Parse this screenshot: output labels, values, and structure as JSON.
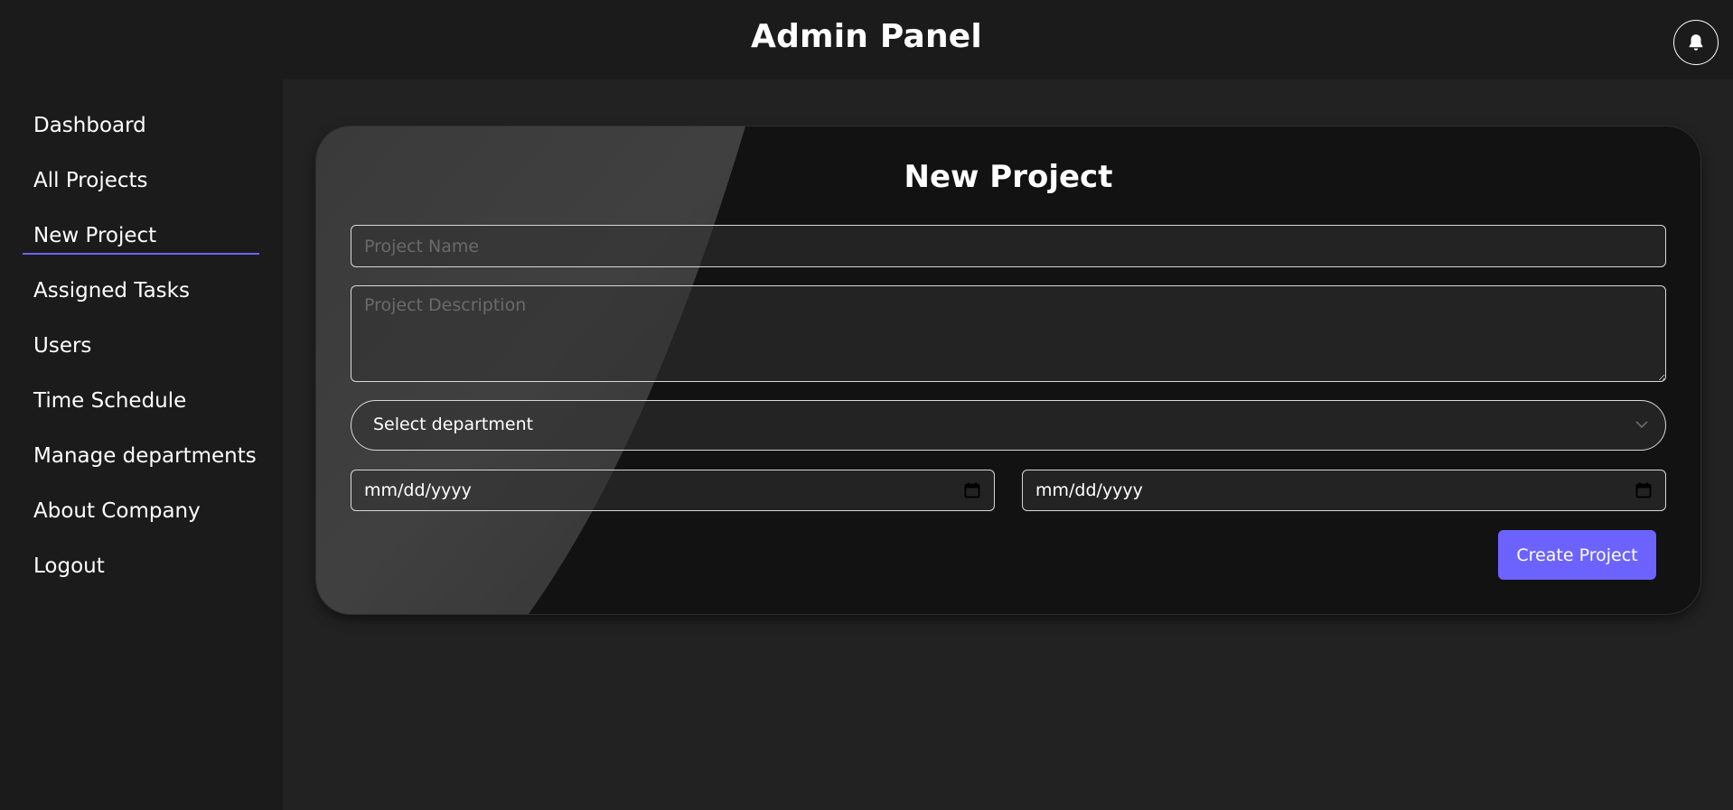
{
  "header": {
    "title": "Admin Panel",
    "bell_icon": "bell-icon"
  },
  "sidebar": {
    "items": [
      {
        "label": "Dashboard"
      },
      {
        "label": "All Projects"
      },
      {
        "label": "New Project"
      },
      {
        "label": "Assigned Tasks"
      },
      {
        "label": "Users"
      },
      {
        "label": "Time Schedule"
      },
      {
        "label": "Manage departments"
      },
      {
        "label": "About Company"
      },
      {
        "label": "Logout"
      }
    ]
  },
  "form": {
    "title": "New Project",
    "project_name_placeholder": "Project Name",
    "project_description_placeholder": "Project Description",
    "department_select": "Select department",
    "start_date": "mm/dd/yyyy",
    "end_date": "mm/dd/yyyy",
    "submit_label": "Create Project"
  },
  "colors": {
    "accent": "#6c63ff",
    "background": "#222222",
    "panel": "#121212",
    "sidebar": "#1b1b1b"
  }
}
